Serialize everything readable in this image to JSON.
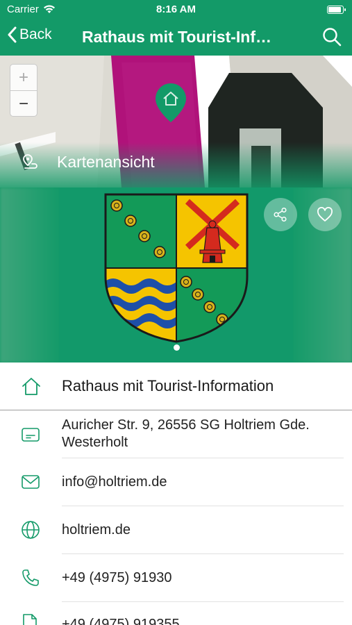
{
  "status_bar": {
    "carrier": "Carrier",
    "time": "8:16 AM"
  },
  "nav": {
    "back_label": "Back",
    "title": "Rathaus mit Tourist-Information",
    "search_icon": "search-icon"
  },
  "map": {
    "zoom_in": "+",
    "zoom_out": "−",
    "map_view_label": "Kartenansicht"
  },
  "hero": {
    "share_icon": "share-icon",
    "favorite_icon": "heart-icon",
    "page_index": 1,
    "page_count": 1
  },
  "details": {
    "title": "Rathaus mit Tourist-Information",
    "address_line1": "Auricher Str. 9, 26556 SG Holtriem Gde.",
    "address_line2": "Westerholt",
    "email": "info@holtriem.de",
    "website": "holtriem.de",
    "phone": "+49 (4975) 91930",
    "fax": "+49 (4975) 919355"
  },
  "colors": {
    "brand_green": "#139a68",
    "icon_green": "#139a68"
  }
}
